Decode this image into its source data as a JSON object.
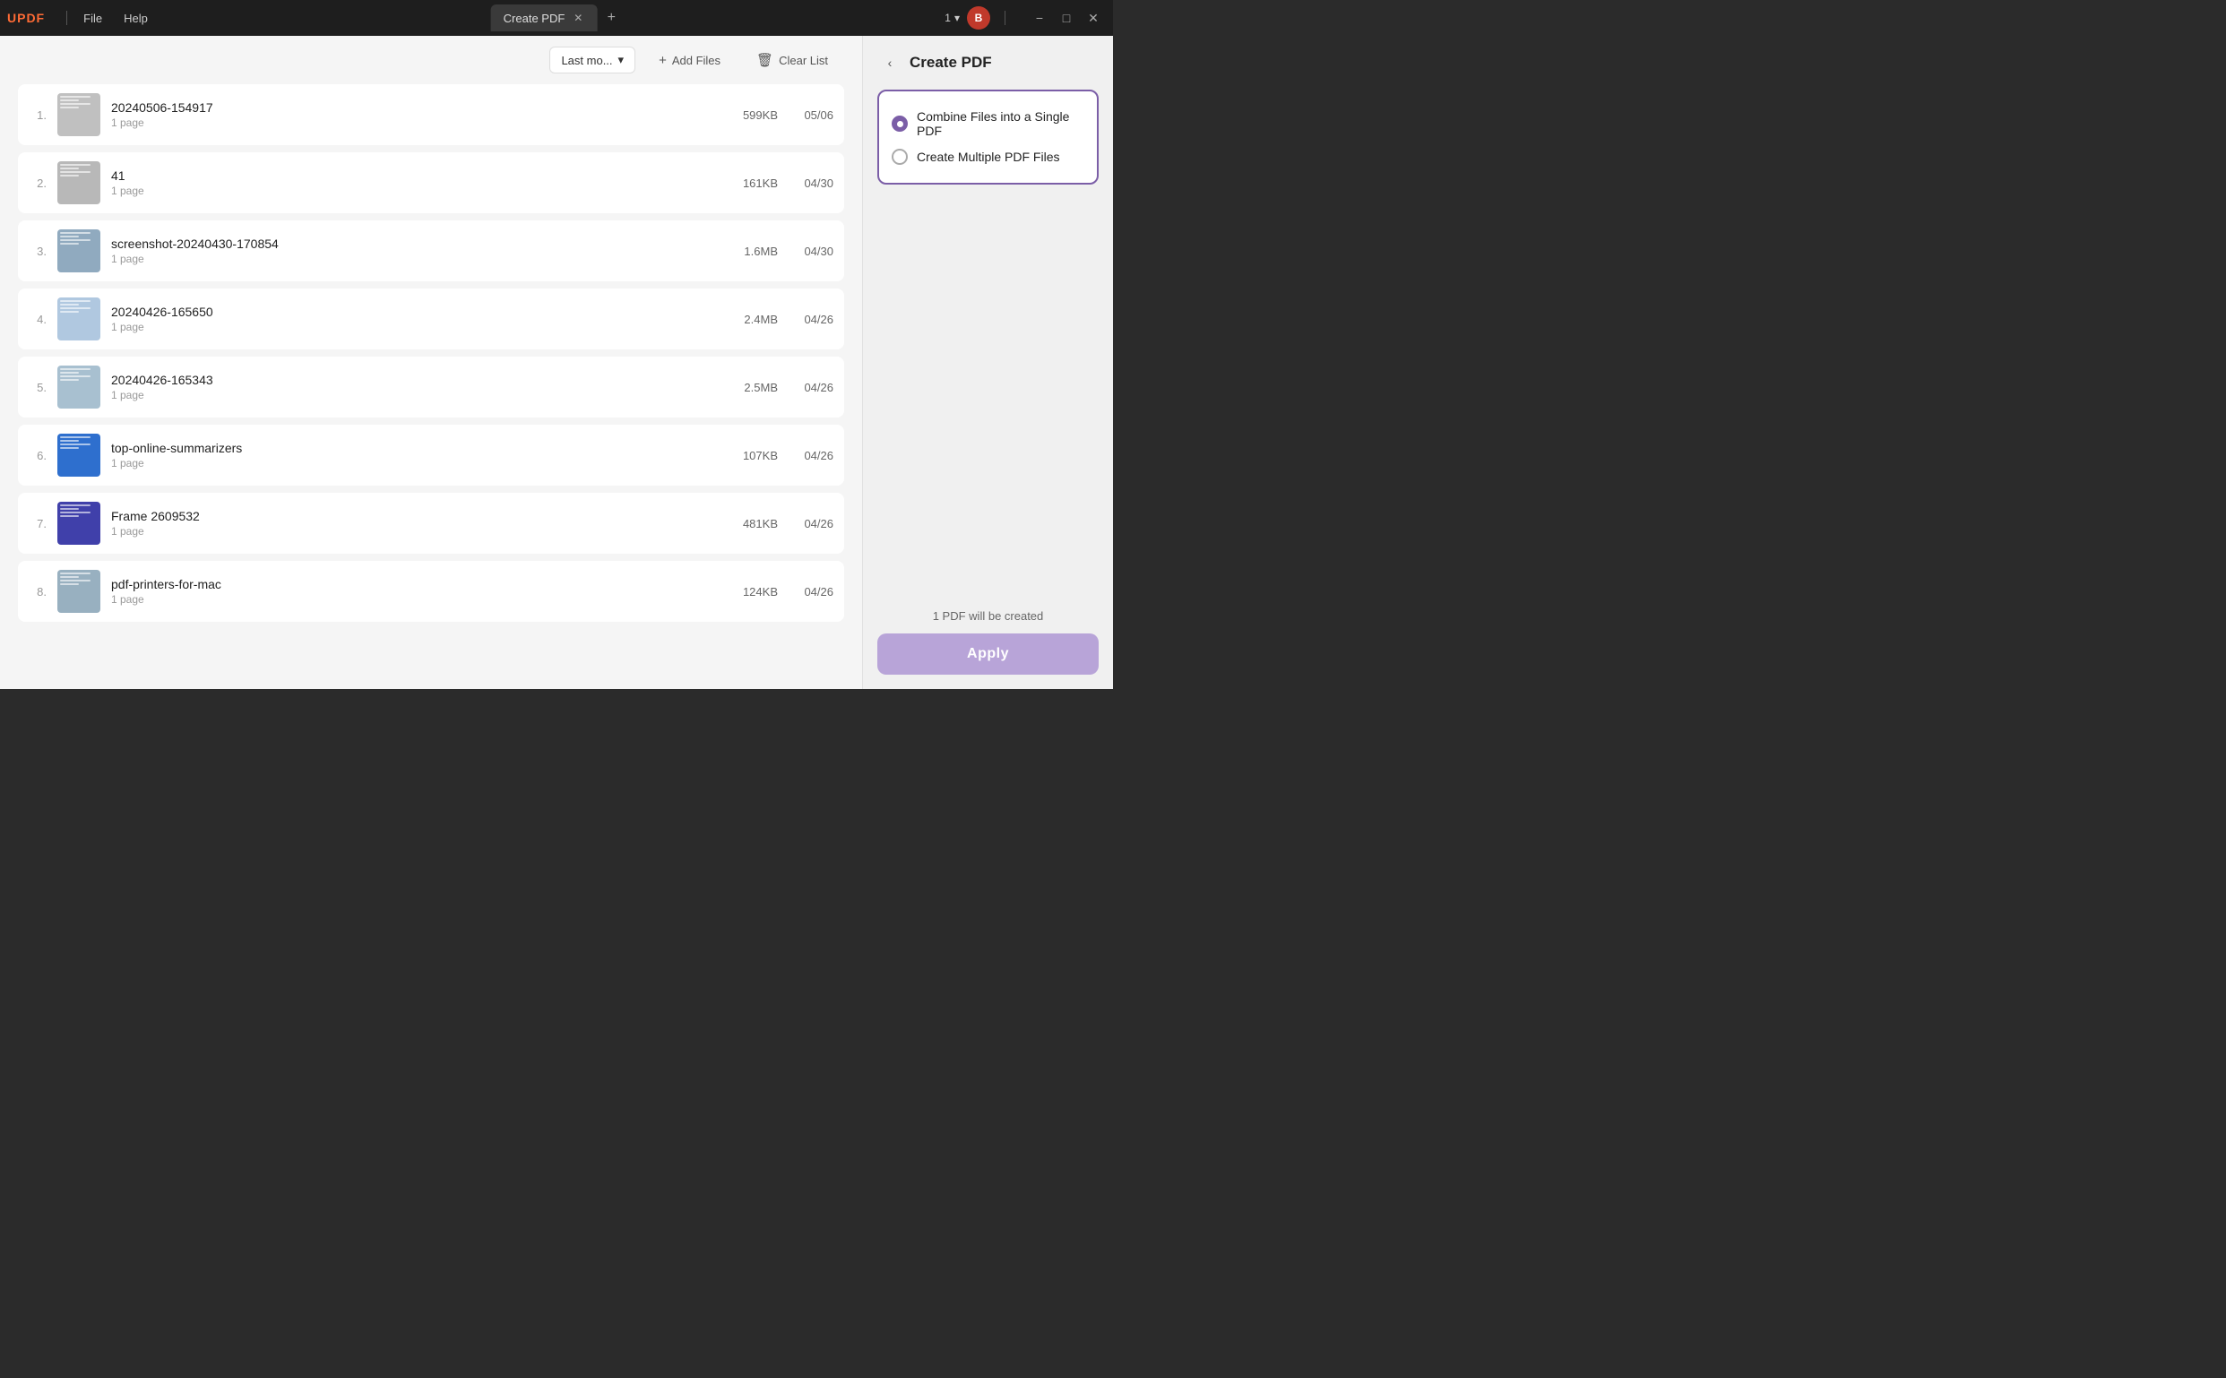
{
  "titlebar": {
    "logo": "UPDF",
    "menu": [
      "File",
      "Help"
    ],
    "tab_label": "Create PDF",
    "version": "1",
    "user_initial": "B",
    "window_buttons": [
      "minimize",
      "maximize",
      "close"
    ]
  },
  "toolbar": {
    "sort_label": "Last mo...",
    "add_files_label": "+ Add Files",
    "clear_list_label": "Clear List"
  },
  "files": [
    {
      "num": "1.",
      "name": "20240506-154917",
      "pages": "1 page",
      "size": "599KB",
      "date": "05/06"
    },
    {
      "num": "2.",
      "name": "41",
      "pages": "1 page",
      "size": "161KB",
      "date": "04/30"
    },
    {
      "num": "3.",
      "name": "screenshot-20240430-170854",
      "pages": "1 page",
      "size": "1.6MB",
      "date": "04/30"
    },
    {
      "num": "4.",
      "name": "20240426-165650",
      "pages": "1 page",
      "size": "2.4MB",
      "date": "04/26"
    },
    {
      "num": "5.",
      "name": "20240426-165343",
      "pages": "1 page",
      "size": "2.5MB",
      "date": "04/26"
    },
    {
      "num": "6.",
      "name": "top-online-summarizers",
      "pages": "1 page",
      "size": "107KB",
      "date": "04/26"
    },
    {
      "num": "7.",
      "name": "Frame 2609532",
      "pages": "1 page",
      "size": "481KB",
      "date": "04/26"
    },
    {
      "num": "8.",
      "name": "pdf-printers-for-mac",
      "pages": "1 page",
      "size": "124KB",
      "date": "04/26"
    }
  ],
  "panel": {
    "back_icon": "‹",
    "title": "Create PDF",
    "option1_label": "Combine Files into a Single PDF",
    "option1_selected": true,
    "option2_label": "Create Multiple PDF Files",
    "option2_selected": false,
    "pdf_count_text": "1 PDF will be created",
    "apply_label": "Apply"
  },
  "thumb_colors": [
    "#c8c8c8",
    "#b0b0b0",
    "#a8c4d8",
    "#c0d8f0",
    "#b8ccdc",
    "#3a7bd5",
    "#4a4aaa",
    "#a0b8c8"
  ]
}
